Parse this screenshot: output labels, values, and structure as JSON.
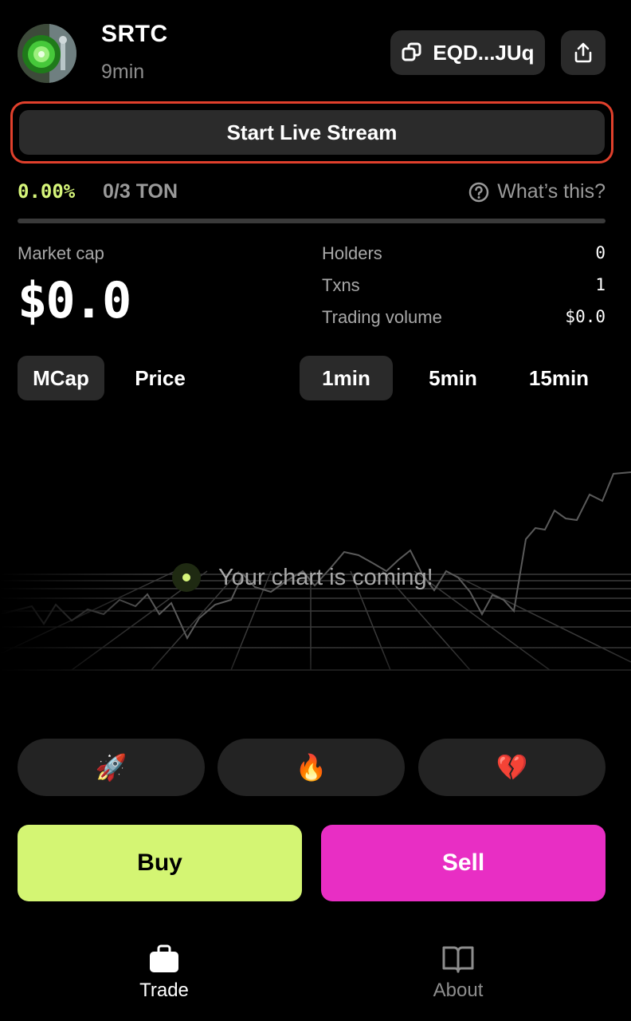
{
  "header": {
    "token_name": "SRTC",
    "age": "9min",
    "address_label": "EQD...JUq"
  },
  "live_stream": {
    "label": "Start Live Stream"
  },
  "progress": {
    "percent_text": "0.00%",
    "ton_text": "0/3 TON",
    "help_text": "What’s this?",
    "fraction": 0.0
  },
  "stats": {
    "market_cap_label": "Market cap",
    "market_cap_value": "$0.0",
    "rows": [
      {
        "label": "Holders",
        "value": "0"
      },
      {
        "label": "Txns",
        "value": "1"
      },
      {
        "label": "Trading volume",
        "value": "$0.0"
      }
    ]
  },
  "chart_toggles": {
    "metric": [
      "MCap",
      "Price"
    ],
    "active_metric": "MCap",
    "intervals": [
      "1min",
      "5min",
      "15min"
    ],
    "active_interval": "1min"
  },
  "chart_placeholder": "Your chart is coming!",
  "reactions": [
    "🚀",
    "🔥",
    "💔"
  ],
  "actions": {
    "buy": "Buy",
    "sell": "Sell"
  },
  "nav": [
    {
      "label": "Trade",
      "icon": "briefcase-icon",
      "active": true
    },
    {
      "label": "About",
      "icon": "book-icon",
      "active": false
    }
  ],
  "colors": {
    "accent_green": "#d4f573",
    "sell_pink": "#e82ec4",
    "highlight_red": "#e0402c"
  }
}
